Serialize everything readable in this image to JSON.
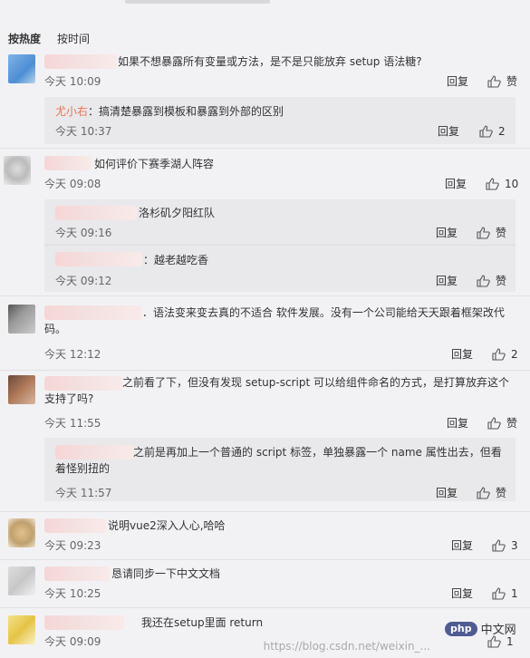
{
  "tabs": [
    "按热度",
    "按时间"
  ],
  "actions": {
    "reply": "回复",
    "like": "赞"
  },
  "comments": [
    {
      "text": "如果不想暴露所有变量或方法，是不是只能放弃 setup 语法糖?",
      "time": "今天 10:09",
      "replies": [
        {
          "author": "尤小右",
          "text": "：搞清楚暴露到模板和暴露到外部的区别",
          "time": "今天 10:37",
          "likes": "2"
        }
      ]
    },
    {
      "text": "如何评价下赛季湖人阵容",
      "time": "今天 09:08",
      "likes": "10",
      "replies": [
        {
          "text": "洛杉矶夕阳红队",
          "time": "今天 09:16"
        },
        {
          "text": "：越老越吃香",
          "time": "今天 09:12"
        }
      ]
    },
    {
      "text": "．语法变来变去真的不适合 软件发展。没有一个公司能给天天跟着框架改代码。",
      "time": "今天 12:12",
      "likes": "2"
    },
    {
      "text": "之前看了下，但没有发现 setup-script 可以给组件命名的方式，是打算放弃这个支持了吗?",
      "time": "今天 11:55",
      "replies": [
        {
          "text": "之前是再加上一个普通的 script 标签，单独暴露一个 name 属性出去，但看着怪别扭的",
          "time": "今天 11:57"
        }
      ]
    },
    {
      "text": "说明vue2深入人心,哈哈",
      "time": "今天 09:23",
      "likes": "3"
    },
    {
      "text": "恳请同步一下中文文档",
      "time": "今天 10:25",
      "likes": "1"
    },
    {
      "text": "我还在setup里面 return",
      "time": "今天 09:09",
      "likes": "1"
    }
  ],
  "logo": {
    "php": "php",
    "cn": "中文网"
  },
  "watermark": "https://blog.csdn.net/weixin_..."
}
